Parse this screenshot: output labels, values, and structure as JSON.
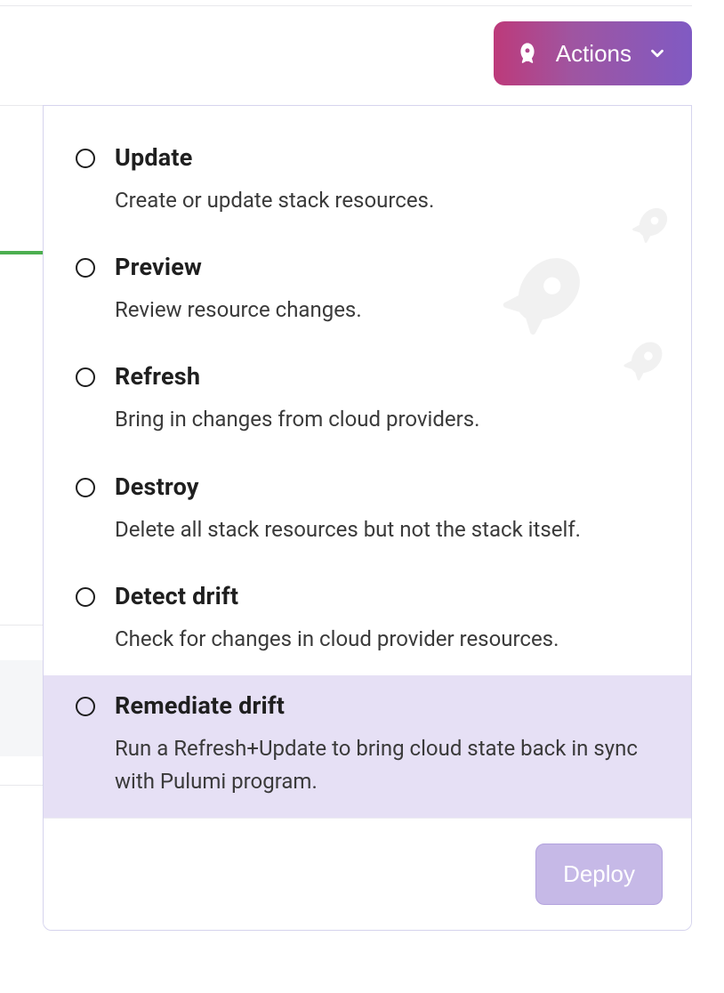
{
  "header": {
    "actions_button_label": "Actions"
  },
  "panel": {
    "options": [
      {
        "id": "update",
        "title": "Update",
        "description": "Create or update stack resources.",
        "highlighted": false
      },
      {
        "id": "preview",
        "title": "Preview",
        "description": "Review resource changes.",
        "highlighted": false
      },
      {
        "id": "refresh",
        "title": "Refresh",
        "description": "Bring in changes from cloud providers.",
        "highlighted": false
      },
      {
        "id": "destroy",
        "title": "Destroy",
        "description": "Delete all stack resources but not the stack itself.",
        "highlighted": false
      },
      {
        "id": "detect",
        "title": "Detect drift",
        "description": "Check for changes in cloud provider resources.",
        "highlighted": false
      },
      {
        "id": "remediate",
        "title": "Remediate drift",
        "description": "Run a Refresh+Update to bring cloud state back in sync with Pulumi program.",
        "highlighted": true
      }
    ],
    "deploy_button_label": "Deploy"
  },
  "icons": {
    "rocket": "rocket-icon",
    "chevron_down": "chevron-down-icon"
  },
  "colors": {
    "button_gradient_start": "#bd3a7a",
    "button_gradient_end": "#805ac3",
    "highlight_bg": "#e6e0f5",
    "deploy_bg": "#c6b9e7",
    "green_tab": "#4caf50"
  }
}
